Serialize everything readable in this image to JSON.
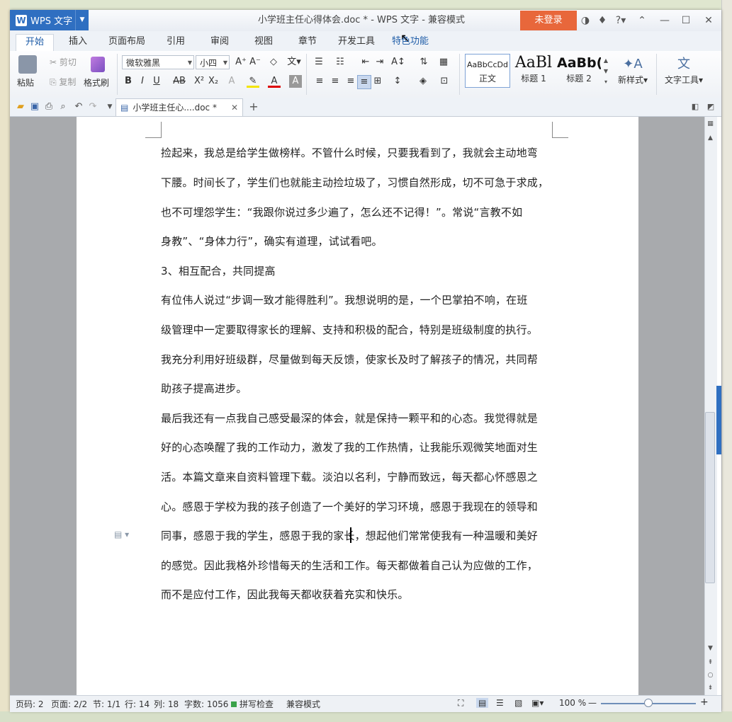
{
  "app": {
    "name": "WPS 文字",
    "window_title": "小学班主任心得体会.doc * - WPS 文字 - 兼容模式",
    "login_label": "未登录"
  },
  "tabs": [
    "开始",
    "插入",
    "页面布局",
    "引用",
    "审阅",
    "视图",
    "章节",
    "开发工具",
    "特色功能"
  ],
  "ribbon": {
    "paste": "粘贴",
    "cut": "剪切",
    "copy": "复制",
    "format_painter": "格式刷",
    "font_name": "微软雅黑",
    "font_size": "小四",
    "styles": [
      {
        "preview": "AaBbCcDd",
        "label": "正文"
      },
      {
        "preview": "AaBl",
        "label": "标题 1"
      },
      {
        "preview": "AaBb(",
        "label": "标题 2"
      }
    ],
    "new_style": "新样式",
    "text_tools": "文字工具"
  },
  "doc_tab": {
    "label": "小学班主任心....doc *"
  },
  "document": {
    "lines": [
      "捡起来，我总是给学生做榜样。不管什么时候，只要我看到了，我就会主动地弯",
      "下腰。时间长了，学生们也就能主动捡垃圾了，习惯自然形成，切不可急于求成，",
      "也不可埋怨学生：“我跟你说过多少遍了，怎么还不记得！”。常说“言教不如",
      "身教”、“身体力行”，确实有道理，试试看吧。",
      "3、相互配合，共同提高",
      "有位伟人说过“步调一致才能得胜利”。我想说明的是，一个巴掌拍不响，在班",
      "级管理中一定要取得家长的理解、支持和积极的配合，特别是班级制度的执行。",
      "我充分利用好班级群，尽量做到每天反馈，使家长及时了解孩子的情况，共同帮",
      "助孩子提高进步。",
      "最后我还有一点我自己感受最深的体会，就是保持一颗平和的心态。我觉得就是",
      "好的心态唤醒了我的工作动力，激发了我的工作热情，让我能乐观微笑地面对生",
      "活。本篇文章来自资料管理下载。淡泊以名利，宁静而致远，每天都心怀感恩之",
      "心。感恩于学校为我的孩子创造了一个美好的学习环境，感恩于我现在的领导和",
      "同事，感恩于我的学生，感恩于我的家长，想起他们常常使我有一种温暖和美好",
      "的感觉。因此我格外珍惜每天的生活和工作。每天都做着自己认为应做的工作，",
      "而不是应付工作，因此我每天都收获着充实和快乐。"
    ]
  },
  "status": {
    "page_num": "页码: 2",
    "pages": "页面: 2/2",
    "section": "节: 1/1",
    "row": "行: 14",
    "col": "列: 18",
    "word_count": "字数: 1056",
    "spell_check": "拼写检查",
    "mode": "兼容模式",
    "zoom": "100 %"
  },
  "zoom_level": 0.5,
  "colors": {
    "accent": "#2f6fc1",
    "login": "#e8673b"
  }
}
